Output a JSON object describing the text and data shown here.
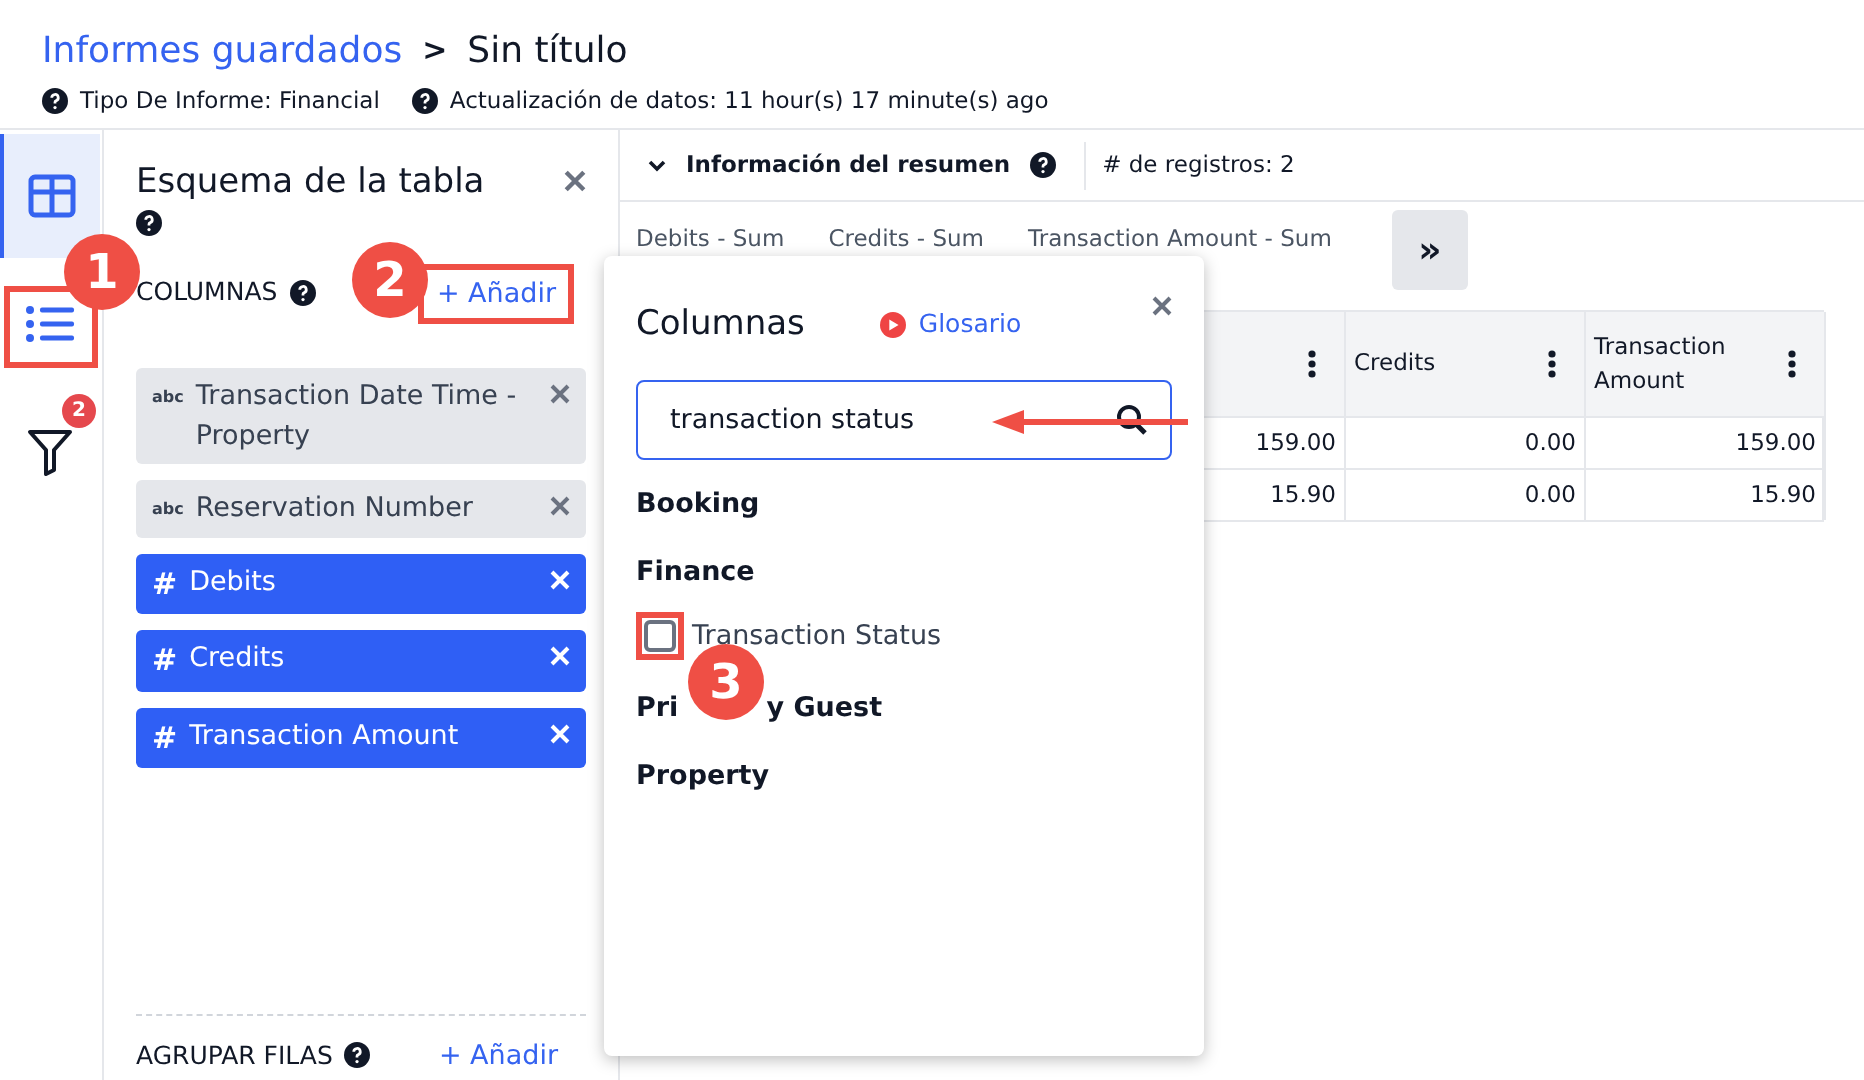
{
  "breadcrumb": {
    "parent": "Informes guardados",
    "separator": ">",
    "current": "Sin título"
  },
  "meta": [
    "Tipo De Informe: Financial",
    "Actualización de datos: 11 hour(s) 17 minute(s) ago"
  ],
  "rail": [
    {
      "kind": "table",
      "selected": true
    },
    {
      "kind": "list",
      "selected": false
    },
    {
      "kind": "filter",
      "selected": false,
      "badge": "2"
    }
  ],
  "schema": {
    "title": "Esquema de la tabla",
    "columns_label": "COLUMNAS",
    "add": "+ Añadir",
    "columns": [
      {
        "type": "abc",
        "label": "Transaction Date Time - Property"
      },
      {
        "type": "abc",
        "label": "Reservation Number"
      },
      {
        "type": "#",
        "label": "Debits"
      },
      {
        "type": "#",
        "label": "Credits"
      },
      {
        "type": "#",
        "label": "Transaction Amount"
      }
    ],
    "group_label": "AGRUPAR FILAS",
    "group_add": "+ Añadir"
  },
  "summary": {
    "title": "Información del resumen",
    "records": "# de registros: 2",
    "sums": [
      "Debits - Sum",
      "Credits - Sum",
      "Transaction Amount - Sum"
    ],
    "expand": "»"
  },
  "table": {
    "columns": [
      "",
      "Credits",
      "Transaction Amount"
    ],
    "rows": [
      [
        "159.00",
        "0.00",
        "159.00"
      ],
      [
        "15.90",
        "0.00",
        "15.90"
      ]
    ]
  },
  "popover": {
    "title": "Columnas",
    "glossary": "Glosario",
    "search": "transaction status",
    "groups": [
      {
        "label": "Booking"
      },
      {
        "label": "Finance",
        "items": [
          {
            "label": "Transaction Status",
            "checked": false
          }
        ]
      },
      {
        "label": "Pri",
        "label_tail": "y Guest"
      },
      {
        "label": "Property"
      }
    ]
  },
  "annotations": [
    "1",
    "2",
    "3"
  ]
}
